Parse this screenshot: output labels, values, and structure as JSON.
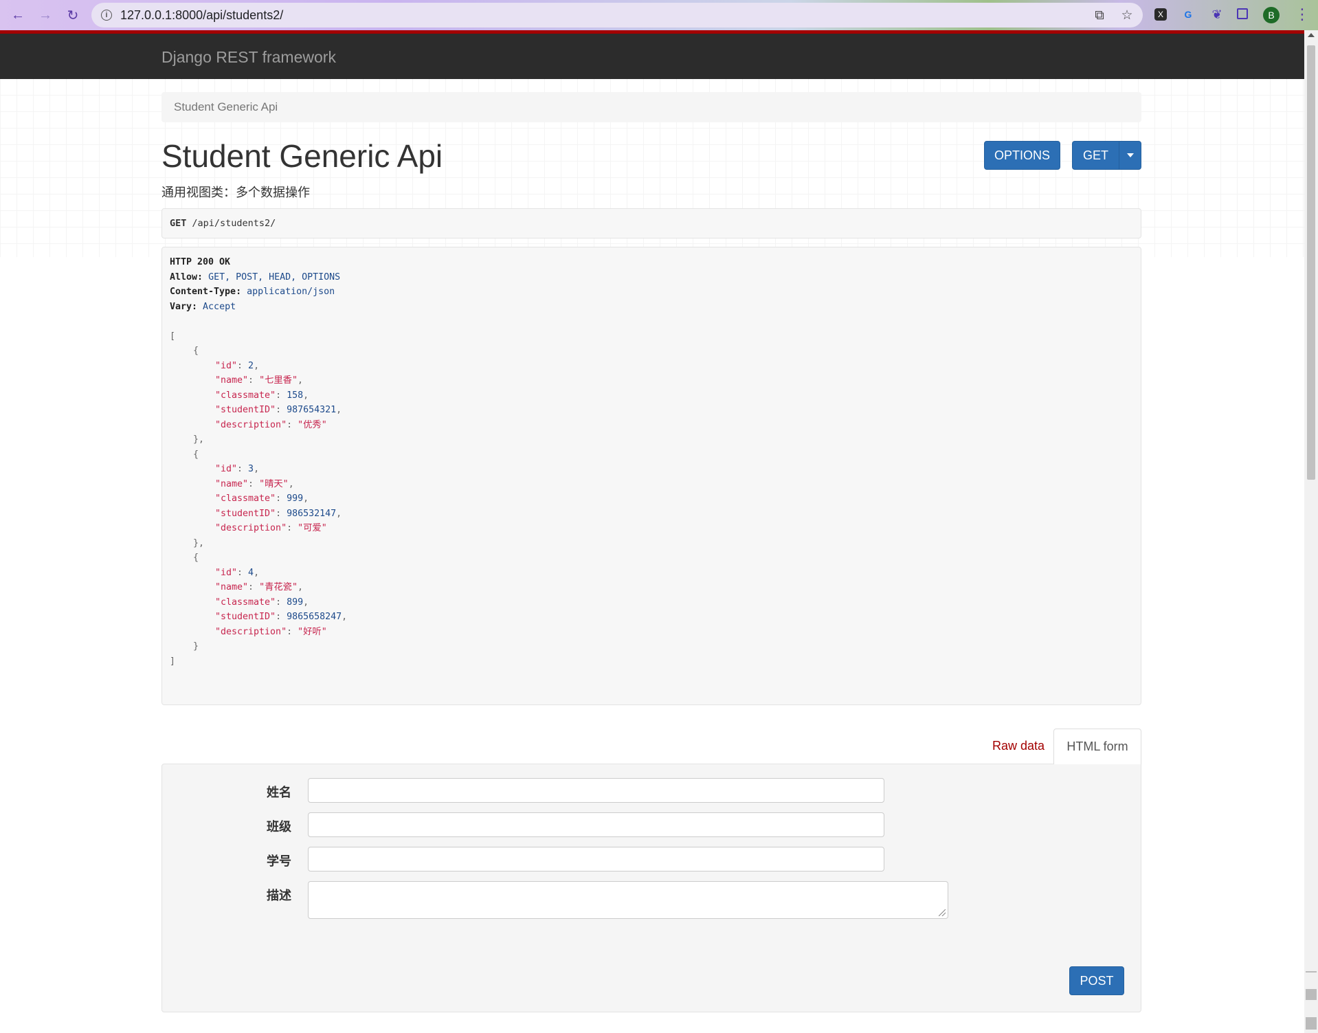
{
  "browser": {
    "url_host": "127.0.0.1",
    "url_path": ":8000/api/students2/",
    "avatar_letter": "B",
    "icons": {
      "back": "back-arrow-icon",
      "forward": "forward-arrow-icon",
      "reload": "reload-icon",
      "info": "site-info-icon",
      "share": "share-icon",
      "bookmark": "star-icon",
      "ext1": "extension-x-icon",
      "ext2": "translate-icon",
      "ext3": "puzzle-icon",
      "sidepanel": "side-panel-icon",
      "menu": "kebab-menu-icon"
    }
  },
  "navbar": {
    "brand": "Django REST framework"
  },
  "breadcrumb": {
    "current": "Student Generic Api"
  },
  "header": {
    "title": "Student Generic Api",
    "description": "通用视图类：多个数据操作",
    "options_label": "OPTIONS",
    "get_label": "GET"
  },
  "request": {
    "method": "GET",
    "path": "/api/students2/"
  },
  "response": {
    "status_line": "HTTP 200 OK",
    "headers": [
      {
        "name": "Allow:",
        "value": "GET, POST, HEAD, OPTIONS"
      },
      {
        "name": "Content-Type:",
        "value": "application/json"
      },
      {
        "name": "Vary:",
        "value": "Accept"
      }
    ],
    "records": [
      {
        "id": "2",
        "name": "七里香",
        "classmate": "158",
        "studentID": "987654321",
        "description": "优秀"
      },
      {
        "id": "3",
        "name": "晴天",
        "classmate": "999",
        "studentID": "986532147",
        "description": "可爱"
      },
      {
        "id": "4",
        "name": "青花瓷",
        "classmate": "899",
        "studentID": "9865658247",
        "description": "好听"
      }
    ]
  },
  "form": {
    "tab_raw": "Raw data",
    "tab_html": "HTML form",
    "fields": [
      {
        "label": "姓名",
        "value": ""
      },
      {
        "label": "班级",
        "value": ""
      },
      {
        "label": "学号",
        "value": ""
      },
      {
        "label": "描述",
        "value": ""
      }
    ],
    "submit_label": "POST"
  },
  "colors": {
    "primary": "#2c6fb5",
    "navbar": "#2c2c2c",
    "accent_red": "#a30000"
  }
}
